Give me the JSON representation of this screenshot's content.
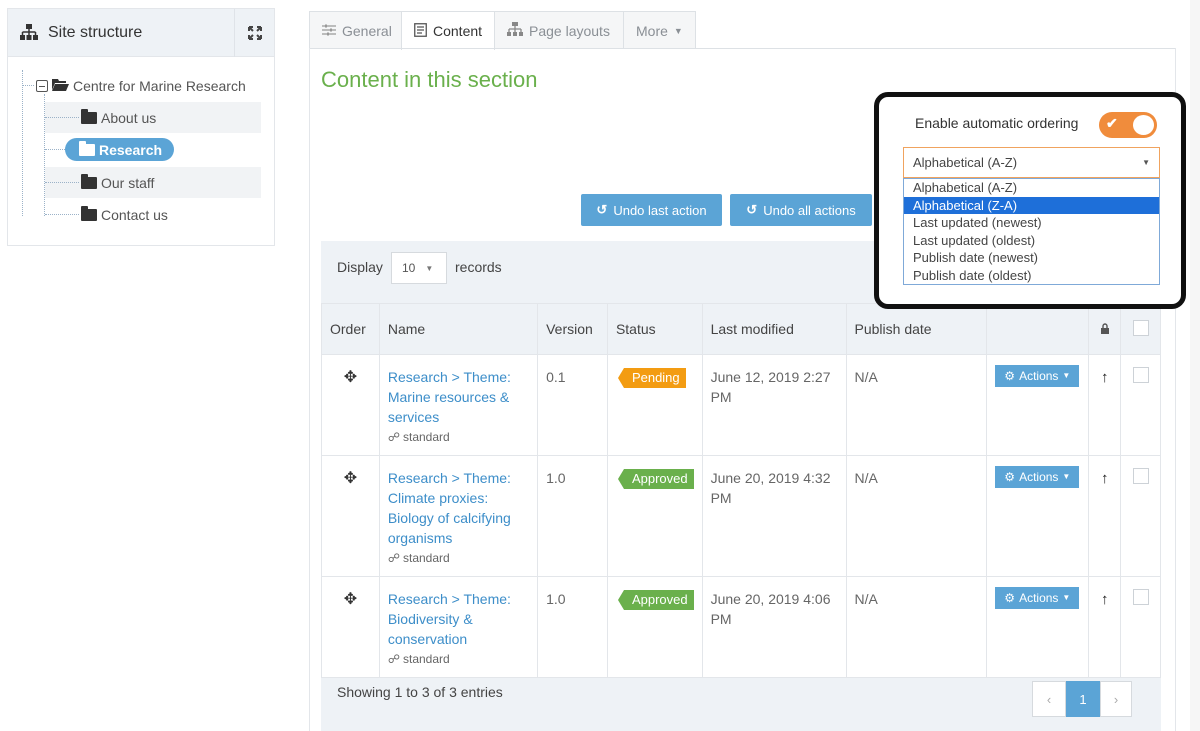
{
  "sidebar": {
    "title": "Site structure",
    "tree": {
      "root": "Centre for Marine Research",
      "children": [
        {
          "label": "About us",
          "selected": false
        },
        {
          "label": "Research",
          "selected": true
        },
        {
          "label": "Our staff",
          "selected": false
        },
        {
          "label": "Contact us",
          "selected": false
        }
      ]
    }
  },
  "tabs": [
    {
      "label": "General",
      "icon": "sliders-icon",
      "active": false
    },
    {
      "label": "Content",
      "icon": "document-icon",
      "active": true
    },
    {
      "label": "Page layouts",
      "icon": "sitemap-icon",
      "active": false
    },
    {
      "label": "More",
      "icon": "caret-down-icon",
      "active": false
    }
  ],
  "main": {
    "title": "Content in this section",
    "buttons": {
      "undo_last": "Undo last action",
      "undo_all": "Undo all actions"
    },
    "display": {
      "label": "Display",
      "value": "10",
      "suffix": "records"
    },
    "table": {
      "headers": {
        "order": "Order",
        "name": "Name",
        "version": "Version",
        "status": "Status",
        "last_modified": "Last modified",
        "publish_date": "Publish date"
      },
      "rows": [
        {
          "name": "Research > Theme: Marine resources & services",
          "type": "standard",
          "version": "0.1",
          "status": "Pending",
          "last_modified": "June 12, 2019 2:27 PM",
          "publish_date": "N/A",
          "actions": "Actions"
        },
        {
          "name": "Research > Theme: Climate proxies: Biology of calcifying organisms",
          "type": "standard",
          "version": "1.0",
          "status": "Approved",
          "last_modified": "June 20, 2019 4:32 PM",
          "publish_date": "N/A",
          "actions": "Actions"
        },
        {
          "name": "Research > Theme: Biodiversity & conservation",
          "type": "standard",
          "version": "1.0",
          "status": "Approved",
          "last_modified": "June 20, 2019 4:06 PM",
          "publish_date": "N/A",
          "actions": "Actions"
        }
      ]
    },
    "showing": "Showing 1 to 3 of 3 entries",
    "pagination": {
      "prev": "‹",
      "current": "1",
      "next": "›"
    }
  },
  "ordering": {
    "enable_label": "Enable automatic ordering",
    "enabled": true,
    "selected": "Alphabetical (A-Z)",
    "options": [
      "Alphabetical (A-Z)",
      "Alphabetical (Z-A)",
      "Last updated (newest)",
      "Last updated (oldest)",
      "Publish date (newest)",
      "Publish date (oldest)"
    ],
    "highlighted_option_index": 1
  },
  "colors": {
    "accent_blue": "#5ba4d6",
    "title_green": "#6ab04c",
    "pending_orange": "#f39c12",
    "toggle_orange": "#f08c3c",
    "highlight_blue": "#1e6fd9"
  }
}
